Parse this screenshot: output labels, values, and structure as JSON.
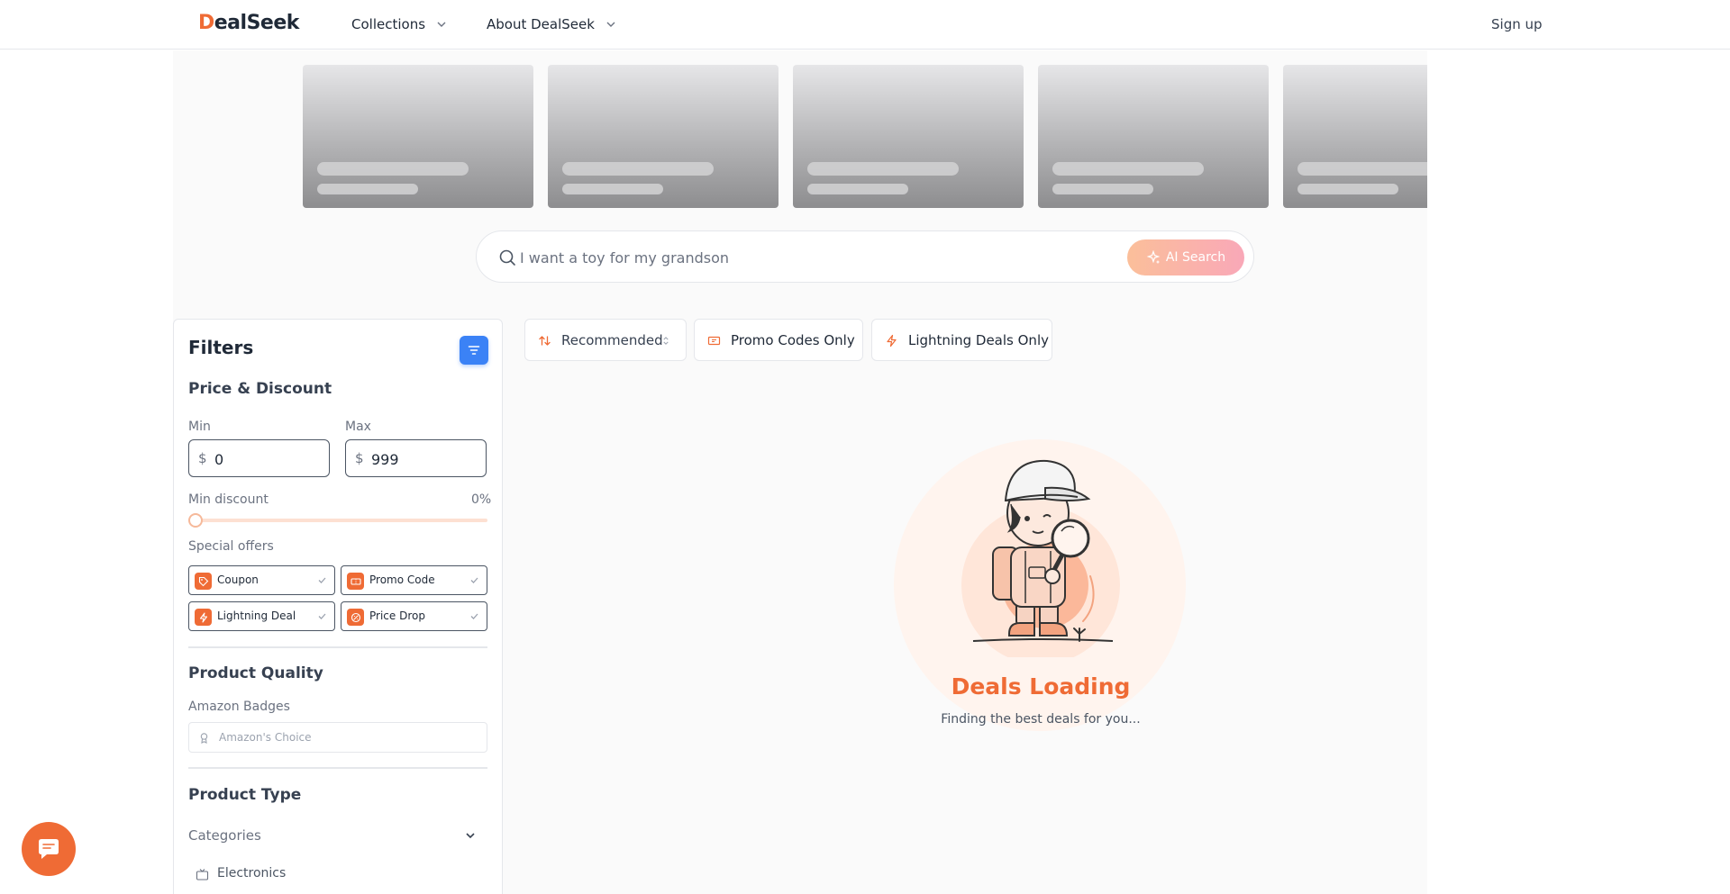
{
  "brand": {
    "logo_first": "D",
    "logo_rest": "ealSeek",
    "accent_color": "#ef6b35"
  },
  "nav": {
    "items": [
      {
        "label": "Collections"
      },
      {
        "label": "About DealSeek"
      }
    ],
    "signup": "Sign up"
  },
  "carousel": {
    "skeleton_cards": 5
  },
  "search": {
    "placeholder": "I want a toy for my grandson",
    "ai_button": "AI Search"
  },
  "filters": {
    "title": "Filters",
    "price_section": "Price & Discount",
    "min_label": "Min",
    "max_label": "Max",
    "currency": "$",
    "min_value": "0",
    "max_value": "999",
    "discount_label": "Min discount",
    "discount_value": "0%",
    "discount_level": 0,
    "special_offers_label": "Special offers",
    "offers": [
      "Coupon",
      "Promo Code",
      "Lightning Deal",
      "Price Drop"
    ],
    "quality_section": "Product Quality",
    "badges_label": "Amazon Badges",
    "badges_placeholder": "Amazon's Choice",
    "type_section": "Product Type",
    "categories_label": "Categories",
    "category_items": [
      "Electronics"
    ]
  },
  "toolbar": {
    "sort_label": "Recommended",
    "promo_only": "Promo Codes Only",
    "lightning_only": "Lightning Deals Only"
  },
  "loading": {
    "title": "Deals Loading",
    "subtitle": "Finding the best deals for you..."
  }
}
